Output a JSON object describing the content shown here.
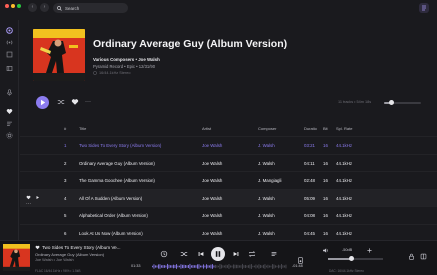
{
  "search": {
    "placeholder": "Search"
  },
  "album": {
    "title": "Ordinary Average Guy (Album Version)",
    "artists": "Various Composers • Joe Walsh",
    "label_line": "Pyramid Record • Epic • 12/31/90",
    "quality": "16/44.1kHz Stereo"
  },
  "actions": {
    "tracks_info": "11 tracks • 54m 18s"
  },
  "volume": {
    "level": 0.2
  },
  "table": {
    "headers": {
      "num": "#",
      "title": "Title",
      "artist": "Artist",
      "composer": "Composer",
      "duration": "Duratio",
      "bit": "Bit",
      "rate": "Spl. Rate"
    },
    "rows": [
      {
        "num": "1",
        "title": "Two Sides To Every Story (Album Version)",
        "artist": "Joe Walsh",
        "composer": "J. Walsh",
        "duration": "03:21",
        "bit": "16",
        "rate": "44.1kHz",
        "active": true
      },
      {
        "num": "2",
        "title": "Ordinary Average Guy (Album Version)",
        "artist": "Joe Walsh",
        "composer": "J. Walsh",
        "duration": "04:11",
        "bit": "16",
        "rate": "44.1kHz"
      },
      {
        "num": "3",
        "title": "The Gamma Goochee (Album Version)",
        "artist": "Joe Walsh",
        "composer": "J. Mangiagli",
        "duration": "02:48",
        "bit": "16",
        "rate": "44.1kHz"
      },
      {
        "num": "4",
        "title": "All Of A Sudden (Album Version)",
        "artist": "Joe Walsh",
        "composer": "J. Walsh",
        "duration": "05:09",
        "bit": "16",
        "rate": "44.1kHz",
        "hover": true
      },
      {
        "num": "5",
        "title": "Alphabetical Order (Album Version)",
        "artist": "Joe Walsh",
        "composer": "J. Walsh",
        "duration": "04:08",
        "bit": "16",
        "rate": "44.1kHz"
      },
      {
        "num": "6",
        "title": "Look At Us Now (Album Version)",
        "artist": "Joe Walsh",
        "composer": "J. Walsh",
        "duration": "04:45",
        "bit": "16",
        "rate": "44.1kHz"
      }
    ]
  },
  "player": {
    "title": "Two Sides To Every Story (Album Ve...",
    "album": "Ordinary Average Guy (Album Version)",
    "artist": "Joe Walsh • Joe Walsh",
    "quality": "FLAC 16/44.1kHz • 96% • 1.5kB",
    "elapsed": "01:33",
    "remaining": "-01:48",
    "progress": 0.46,
    "volume_db": "-50dB",
    "volume_level": 0.42,
    "output": "DAC: 16/44.1kHz Stereo"
  },
  "colors": {
    "accent": "#8c7cf0",
    "background": "#1a1a1e"
  }
}
